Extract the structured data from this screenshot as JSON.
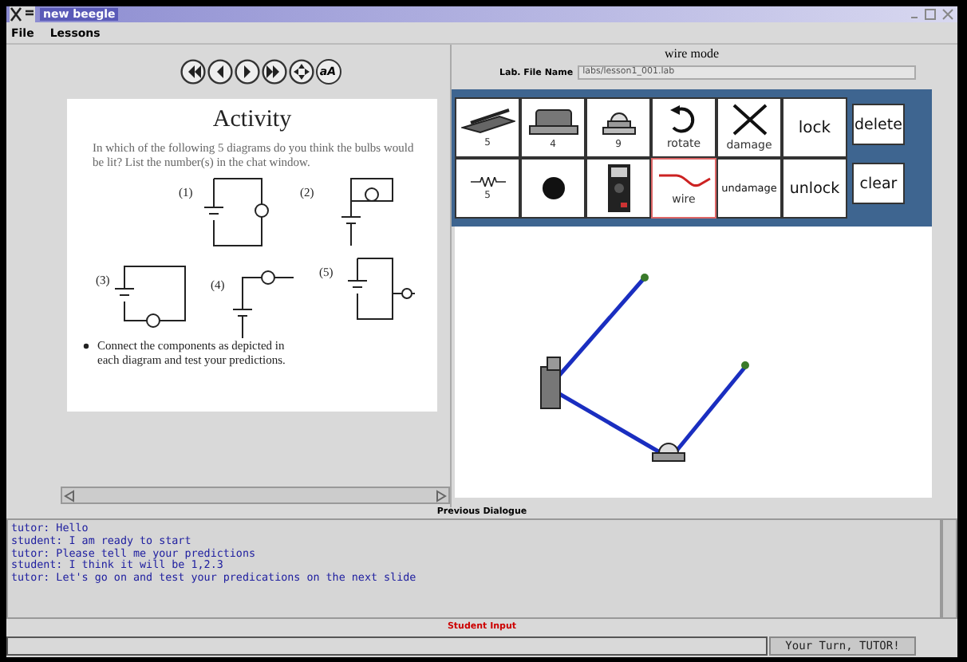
{
  "window": {
    "title": "new beegle"
  },
  "menu": [
    {
      "label": "File"
    },
    {
      "label": "Lessons"
    }
  ],
  "nav_buttons": [
    {
      "kind": "first"
    },
    {
      "kind": "prev"
    },
    {
      "kind": "next"
    },
    {
      "kind": "last"
    },
    {
      "kind": "move"
    },
    {
      "kind": "font",
      "label": "aA"
    }
  ],
  "slide": {
    "title": "Activity",
    "question": "In which of the following 5 diagrams do you think the bulbs would be lit?  List the number(s) in the chat window.",
    "diagrams": [
      {
        "label": "(1)",
        "kind": "closed"
      },
      {
        "label": "(2)",
        "kind": "short"
      },
      {
        "label": "(3)",
        "kind": "closed-bottom"
      },
      {
        "label": "(4)",
        "kind": "open"
      },
      {
        "label": "(5)",
        "kind": "side"
      }
    ],
    "bullet": "Connect the components as depicted in each diagram and test your predictions."
  },
  "lab": {
    "mode": "wire mode",
    "file_label": "Lab. File Name",
    "file_value": "labs/lesson1_001.lab"
  },
  "tools": [
    {
      "kind": "battery",
      "label": "5",
      "selected": false
    },
    {
      "kind": "motor",
      "label": "4",
      "selected": false
    },
    {
      "kind": "bulb",
      "label": "9",
      "selected": false
    },
    {
      "kind": "rotate",
      "label": "rotate",
      "selected": false
    },
    {
      "kind": "damage",
      "label": "damage",
      "selected": false
    },
    {
      "kind": "text",
      "label": "lock",
      "selected": false
    },
    {
      "kind": "resistor",
      "label": "5",
      "selected": false
    },
    {
      "kind": "junction",
      "selected": false
    },
    {
      "kind": "meter",
      "selected": false
    },
    {
      "kind": "wire",
      "label": "wire",
      "selected": true
    },
    {
      "kind": "text",
      "label": "undamage",
      "selected": false
    },
    {
      "kind": "text",
      "label": "unlock",
      "selected": false
    }
  ],
  "buttons": [
    {
      "label": "delete"
    },
    {
      "label": "clear"
    }
  ],
  "dialogue": {
    "title": "Previous Dialogue",
    "lines": [
      "tutor: Hello",
      "student: I am ready to start",
      "tutor: Please tell me your predictions",
      "student: I think it will be 1,2.3",
      "tutor: Let's go on and test your predications on the next slide"
    ]
  },
  "input": {
    "title": "Student Input",
    "button": "Your Turn, TUTOR!"
  }
}
